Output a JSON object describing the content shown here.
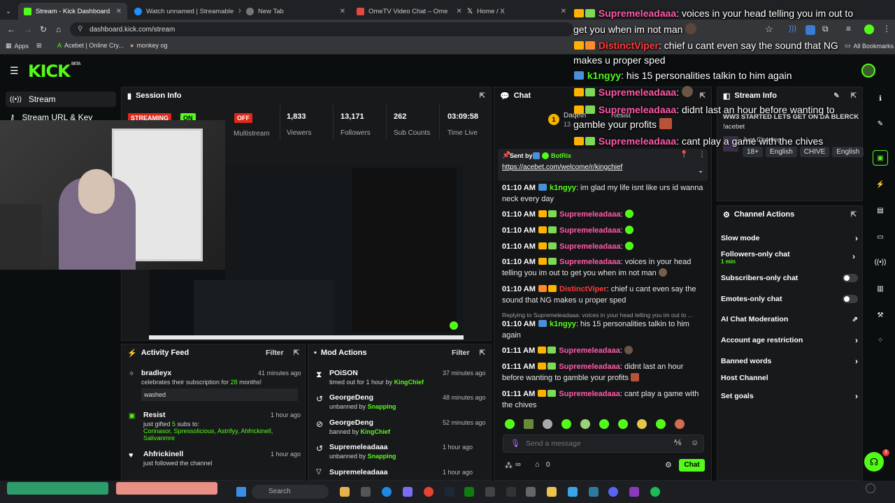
{
  "browser": {
    "tabs": [
      {
        "label": "Stream - Kick Dashboard",
        "active": true
      },
      {
        "label": "Watch unnamed | Streamable"
      },
      {
        "label": "New Tab"
      },
      {
        "label": "OmeTV Video Chat – Ome"
      },
      {
        "label": "Home / X"
      }
    ],
    "url": "dashboard.kick.com/stream",
    "bookmarks": [
      "Apps",
      "Acebet | Online Cry...",
      "monkey og"
    ],
    "all_bookmarks": "All Bookmarks"
  },
  "brand": {
    "logo": "KICK",
    "beta": "BETA",
    "accent": "#53fc18"
  },
  "sidebar": {
    "items": [
      "Stream",
      "Stream URL & Key"
    ]
  },
  "session": {
    "title": "Session Info",
    "streaming_badge": "STREAMING",
    "on_badge": "ON",
    "off_badge": "OFF",
    "multistream_label": "Multistream",
    "stats": [
      {
        "value": "1,833",
        "label": "Viewers"
      },
      {
        "value": "13,171",
        "label": "Followers"
      },
      {
        "value": "262",
        "label": "Sub Counts"
      },
      {
        "value": "03:09:58",
        "label": "Time Live"
      }
    ]
  },
  "chat": {
    "title": "Chat",
    "top_gifter": "Daqeth",
    "top_gifter_count": "13",
    "top_gifter_badge": "1",
    "resist": "Resist",
    "pinned": {
      "sent_by": "Sent by",
      "user": "BotRix",
      "link": "https://acebet.com/welcome/r/kingchief"
    },
    "messages": [
      {
        "time": "01:10 AM",
        "user": "k1ngyy",
        "text": ": im glad my life isnt like urs id wanna neck every day",
        "color": "#53fc18"
      },
      {
        "time": "01:10 AM",
        "user": "Supremeleadaaa",
        "text": ":",
        "color": "#ff5aa8"
      },
      {
        "time": "01:10 AM",
        "user": "Supremeleadaaa",
        "text": ":",
        "color": "#ff5aa8"
      },
      {
        "time": "01:10 AM",
        "user": "Supremeleadaaa",
        "text": ":",
        "color": "#ff5aa8"
      },
      {
        "time": "01:10 AM",
        "user": "Supremeleadaaa",
        "text": ": voices in your head telling you im out to get you when im not man",
        "color": "#ff5aa8"
      },
      {
        "time": "01:10 AM",
        "user": "DistinctViper",
        "text": ": chief u cant even say the sound that NG makes u proper sped",
        "color": "#ff3a3a"
      },
      {
        "time": "01:10 AM",
        "user": "k1ngyy",
        "text": ": his 15 personalities talkin to him again",
        "color": "#53fc18"
      },
      {
        "time": "01:11 AM",
        "user": "Supremeleadaaa",
        "text": ":",
        "color": "#ff5aa8"
      },
      {
        "time": "01:11 AM",
        "user": "Supremeleadaaa",
        "text": ": didnt last an hour before wanting to gamble your profits",
        "color": "#ff5aa8"
      },
      {
        "time": "01:11 AM",
        "user": "Supremeleadaaa",
        "text": ": cant play a game with the chives",
        "color": "#ff5aa8"
      }
    ],
    "reply_note": "Replying to Supremeleadaaa: voices in your head telling you im out to ...",
    "placeholder": "Send a message",
    "send_label": "Chat",
    "viewer_count_icon": "∞",
    "points": "0"
  },
  "overlay": [
    {
      "user": "Supremeleadaaa",
      "text": ": voices in your head telling you im out to"
    },
    {
      "user": "",
      "text": "get you when im not man"
    },
    {
      "user": "DistinctViper",
      "text": ": chief u cant even say the sound that NG"
    },
    {
      "user": "",
      "text": "makes u proper sped"
    },
    {
      "user": "k1ngyy",
      "text": ": his 15 personalities talkin to him again"
    },
    {
      "user": "Supremeleadaaa",
      "text": ":"
    },
    {
      "user": "Supremeleadaaa",
      "text": ": didnt last an hour before wanting to"
    },
    {
      "user": "",
      "text": "gamble your profits"
    },
    {
      "user": "Supremeleadaaa",
      "text": ": cant play a game with the chives"
    }
  ],
  "stream_info": {
    "title": "Stream Info",
    "stream_title": "WW3 STARTED LETS GET ON DA BLERCK",
    "tag_line": "!acebet",
    "category": "Just Chatting",
    "tags": [
      "18+",
      "English",
      "CHIVE",
      "English"
    ]
  },
  "channel_actions": {
    "title": "Channel Actions",
    "items": [
      {
        "label": "Slow mode",
        "kind": "chevron"
      },
      {
        "label": "Followers-only chat",
        "sub": "1 min",
        "kind": "chevron"
      },
      {
        "label": "Subscribers-only chat",
        "kind": "toggle"
      },
      {
        "label": "Emotes-only chat",
        "kind": "toggle"
      },
      {
        "label": "AI Chat Moderation",
        "kind": "external"
      },
      {
        "label": "Account age restriction",
        "kind": "chevron"
      },
      {
        "label": "Banned words",
        "kind": "chevron"
      },
      {
        "label": "Host Channel",
        "kind": "none"
      },
      {
        "label": "Set goals",
        "kind": "chevron"
      }
    ]
  },
  "activity_feed": {
    "title": "Activity Feed",
    "filter": "Filter",
    "items": [
      {
        "name": "bradleyx",
        "desc_pre": "celebrates their subscription for ",
        "desc_hl": "28",
        "desc_post": " months!",
        "note": "washed",
        "time": "41 minutes ago"
      },
      {
        "name": "Resist",
        "desc_pre": "just gifted ",
        "desc_hl": "5",
        "desc_post": " subs to:",
        "recipients": "Corinasor, Spressolicious, Astrifyy, Ahfrickinell, Salivanmre",
        "time": "1 hour ago"
      },
      {
        "name": "Ahfrickinell",
        "desc_pre": "just followed the channel",
        "time": "1 hour ago"
      }
    ]
  },
  "mod_actions": {
    "title": "Mod Actions",
    "filter": "Filter",
    "items": [
      {
        "name": "POiSON",
        "action": "timed out for 1 hour by ",
        "by": "KingChief",
        "time": "37 minutes ago"
      },
      {
        "name": "GeorgeDeng",
        "action": "unbanned by ",
        "by": "Snapping",
        "time": "48 minutes ago"
      },
      {
        "name": "GeorgeDeng",
        "action": "banned by ",
        "by": "KingChief",
        "time": "52 minutes ago"
      },
      {
        "name": "Supremeleadaaa",
        "action": "unbanned by ",
        "by": "Snapping",
        "time": "1 hour ago"
      },
      {
        "name": "Supremeleadaaa",
        "action": "",
        "by": "",
        "time": "1 hour ago"
      }
    ]
  },
  "taskbar": {
    "search": "Search"
  },
  "support_badge": "3"
}
